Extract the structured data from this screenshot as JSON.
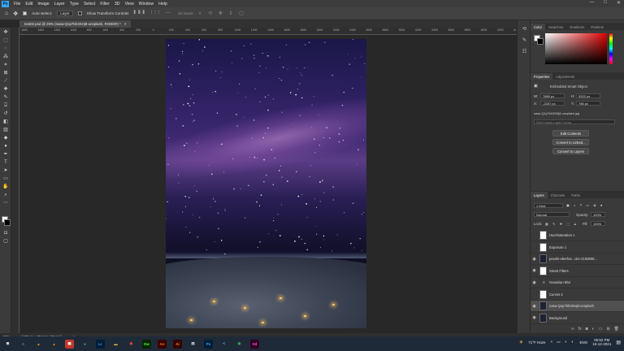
{
  "menu": {
    "logo": "Ps",
    "items": [
      "File",
      "Edit",
      "Image",
      "Layer",
      "Type",
      "Select",
      "Filter",
      "3D",
      "View",
      "Window",
      "Help"
    ],
    "window_controls": [
      "—",
      "□",
      "✕"
    ]
  },
  "options_bar": {
    "auto_select_label": "Auto-Select:",
    "auto_select_value": "Layer",
    "show_transform_label": "Show Transform Controls",
    "mode_label": "3D Mode:"
  },
  "document": {
    "tab_title": "test02.psd @ 25% (nasa-Q1p7bh3SHj8-unsplash, RGB/8#) *",
    "tab_close": "×"
  },
  "ruler": {
    "h_ticks": [
      "1600",
      "1400",
      "1200",
      "1000",
      "800",
      "600",
      "400",
      "200",
      "0",
      "200",
      "400",
      "600",
      "800",
      "1000",
      "1200",
      "1400",
      "1600",
      "1800",
      "2000",
      "2200",
      "2400",
      "2600",
      "2800",
      "3000",
      "3200",
      "3400",
      "3600",
      "3800",
      "4000",
      "4200",
      "4\\"
    ]
  },
  "status": {
    "zoom": "25%",
    "doc_size": "2476 px x 3544 px (72 ppi)",
    "arrow": ">"
  },
  "taskbar": {
    "apps": [
      {
        "name": "start-icon",
        "glyph": "⊞",
        "bg": "#1f2a38",
        "fg": "#ffffff"
      },
      {
        "name": "search-icon",
        "glyph": "○",
        "bg": "#1f2a38",
        "fg": "#ffffff"
      },
      {
        "name": "vlc-icon",
        "glyph": "▲",
        "bg": "#1f2a38",
        "fg": "#ff8800"
      },
      {
        "name": "vlc2-icon",
        "glyph": "▲",
        "bg": "#1f2a38",
        "fg": "#ff8800"
      },
      {
        "name": "tv-icon",
        "glyph": "▣",
        "bg": "#c0392b",
        "fg": "#ffffff"
      },
      {
        "name": "whatsapp-icon",
        "glyph": "●",
        "bg": "#1f2a38",
        "fg": "#25d366"
      },
      {
        "name": "lightroom-icon",
        "glyph": "Lr",
        "bg": "#001e36",
        "fg": "#31a8ff"
      },
      {
        "name": "folder-icon",
        "glyph": "▬",
        "bg": "#1f2a38",
        "fg": "#f5c242"
      },
      {
        "name": "chrome-icon",
        "glyph": "◉",
        "bg": "#1f2a38",
        "fg": "#e8453c"
      },
      {
        "name": "dreamweaver-icon",
        "glyph": "Dw",
        "bg": "#072401",
        "fg": "#4aff46"
      },
      {
        "name": "animate-icon",
        "glyph": "An",
        "bg": "#3a0000",
        "fg": "#ff7c00"
      },
      {
        "name": "illustrator-icon",
        "glyph": "Ai",
        "bg": "#330000",
        "fg": "#ff9a00"
      },
      {
        "name": "files-icon",
        "glyph": "▤",
        "bg": "#1f2a38",
        "fg": "#cccccc"
      },
      {
        "name": "photoshop-icon",
        "glyph": "Ps",
        "bg": "#001e36",
        "fg": "#31a8ff"
      },
      {
        "name": "vscode-icon",
        "glyph": "≺",
        "bg": "#1f2a38",
        "fg": "#3b9cf0"
      },
      {
        "name": "chrome2-icon",
        "glyph": "◉",
        "bg": "#1f2a38",
        "fg": "#34a853"
      },
      {
        "name": "xd-icon",
        "glyph": "Xd",
        "bg": "#2e001f",
        "fg": "#ff61f6"
      }
    ],
    "weather": "71°F  Haze",
    "lang": "ENG",
    "time": "05:52 PM",
    "date": "16-12-2021"
  },
  "color_panel": {
    "tabs": [
      "Color",
      "Swatches",
      "Gradients",
      "Patterns"
    ],
    "foreground": "#ffffff",
    "background": "#000000"
  },
  "properties_panel": {
    "tabs": [
      "Properties",
      "Adjustments"
    ],
    "type": "Embedded Smart Object",
    "w_label": "W:",
    "w_value": "7889 px",
    "h_label": "H:",
    "h_value": "5322 px",
    "x_label": "X:",
    "x_value": "-2267 px",
    "y_label": "Y:",
    "y_value": "786 px",
    "filename": "nasa-Q1p7bh3SHj8-unsplash.jpg",
    "comp_placeholder": "Don't Apply Layer Comp",
    "buttons": [
      "Edit Contents",
      "Convert to Linked...",
      "Convert to Layers"
    ]
  },
  "layers_panel": {
    "tabs": [
      "Layers",
      "Channels",
      "Paths"
    ],
    "filter_label": "Kind",
    "blend_mode": "Normal",
    "opacity_label": "Opacity:",
    "opacity_value": "100%",
    "lock_label": "Lock:",
    "fill_label": "Fill:",
    "fill_value": "100%",
    "layers": [
      {
        "name": "Hue/Saturation 1",
        "visible": false,
        "thumb": "white",
        "selected": false
      },
      {
        "name": "Exposure 1",
        "visible": false,
        "thumb": "white",
        "selected": false
      },
      {
        "name": "pexels-eberhar...cke-2150808...",
        "visible": true,
        "thumb": "dark",
        "selected": false
      },
      {
        "name": "Smart Filters",
        "visible": true,
        "thumb": "white",
        "selected": false
      },
      {
        "name": "Gaussian Blur",
        "visible": true,
        "thumb": "none",
        "selected": false
      },
      {
        "name": "Curves 2",
        "visible": false,
        "thumb": "white",
        "selected": false
      },
      {
        "name": "nasa-Q1p7bh3SHj8-unsplash",
        "visible": true,
        "thumb": "dark",
        "selected": true
      },
      {
        "name": "Background",
        "visible": true,
        "thumb": "dark",
        "selected": false
      }
    ],
    "footer_icons": [
      "link-icon",
      "fx-icon",
      "mask-icon",
      "adjustment-icon",
      "group-icon",
      "new-layer-icon",
      "trash-icon"
    ]
  }
}
